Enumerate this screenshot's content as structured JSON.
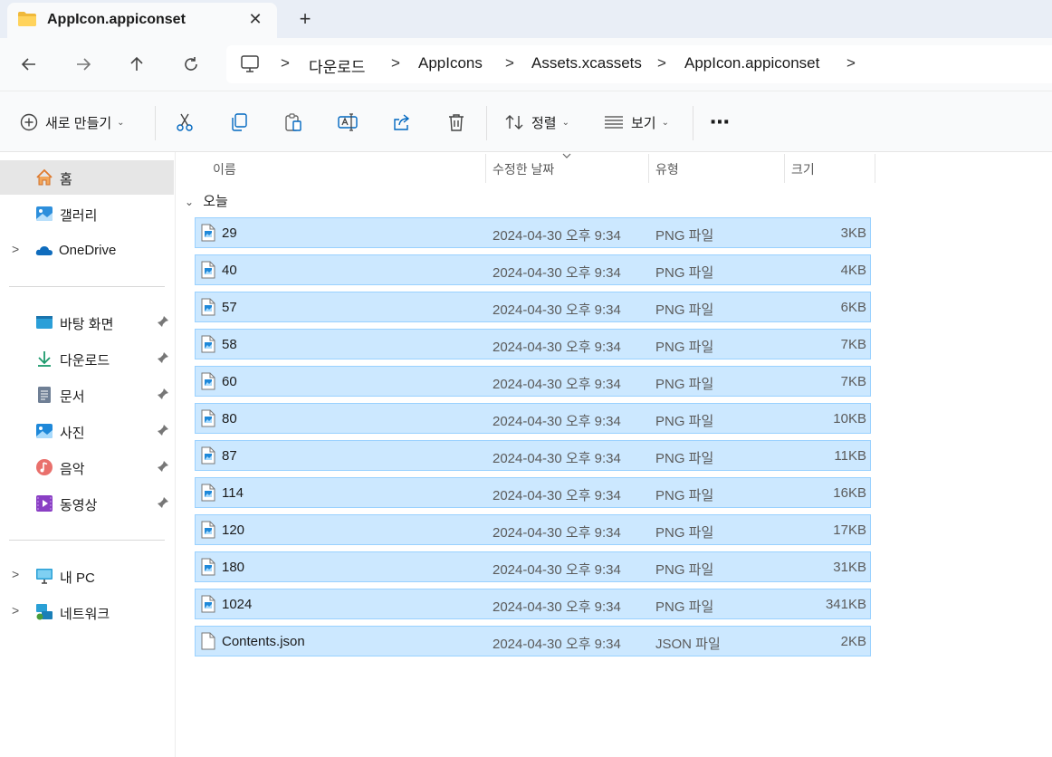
{
  "tab": {
    "title": "AppIcon.appiconset",
    "close": "✕",
    "new_tab": "+"
  },
  "address": {
    "crumbs": [
      "다운로드",
      "AppIcons",
      "Assets.xcassets",
      "AppIcon.appiconset"
    ],
    "separator": ">"
  },
  "commands": {
    "new": "새로 만들기",
    "sort": "정렬",
    "view": "보기",
    "more": "⋯"
  },
  "sidebar": {
    "items": [
      {
        "label": "홈",
        "icon": "home-icon"
      },
      {
        "label": "갤러리",
        "icon": "gallery-icon"
      },
      {
        "label": "OneDrive",
        "icon": "onedrive-icon"
      },
      {
        "label": "바탕 화면",
        "icon": "desktop-icon"
      },
      {
        "label": "다운로드",
        "icon": "download-icon"
      },
      {
        "label": "문서",
        "icon": "documents-icon"
      },
      {
        "label": "사진",
        "icon": "pictures-icon"
      },
      {
        "label": "음악",
        "icon": "music-icon"
      },
      {
        "label": "동영상",
        "icon": "videos-icon"
      },
      {
        "label": "내 PC",
        "icon": "this-pc-icon"
      },
      {
        "label": "네트워크",
        "icon": "network-icon"
      }
    ]
  },
  "columns": {
    "name": "이름",
    "modified": "수정한 날짜",
    "type": "유형",
    "size": "크기"
  },
  "group": {
    "label": "오늘"
  },
  "files": [
    {
      "name": "29",
      "date": "2024-04-30 오후 9:34",
      "type": "PNG 파일",
      "size": "3KB"
    },
    {
      "name": "40",
      "date": "2024-04-30 오후 9:34",
      "type": "PNG 파일",
      "size": "4KB"
    },
    {
      "name": "57",
      "date": "2024-04-30 오후 9:34",
      "type": "PNG 파일",
      "size": "6KB"
    },
    {
      "name": "58",
      "date": "2024-04-30 오후 9:34",
      "type": "PNG 파일",
      "size": "7KB"
    },
    {
      "name": "60",
      "date": "2024-04-30 오후 9:34",
      "type": "PNG 파일",
      "size": "7KB"
    },
    {
      "name": "80",
      "date": "2024-04-30 오후 9:34",
      "type": "PNG 파일",
      "size": "10KB"
    },
    {
      "name": "87",
      "date": "2024-04-30 오후 9:34",
      "type": "PNG 파일",
      "size": "11KB"
    },
    {
      "name": "114",
      "date": "2024-04-30 오후 9:34",
      "type": "PNG 파일",
      "size": "16KB"
    },
    {
      "name": "120",
      "date": "2024-04-30 오후 9:34",
      "type": "PNG 파일",
      "size": "17KB"
    },
    {
      "name": "180",
      "date": "2024-04-30 오후 9:34",
      "type": "PNG 파일",
      "size": "31KB"
    },
    {
      "name": "1024",
      "date": "2024-04-30 오후 9:34",
      "type": "PNG 파일",
      "size": "341KB"
    },
    {
      "name": "Contents.json",
      "date": "2024-04-30 오후 9:34",
      "type": "JSON 파일",
      "size": "2KB"
    }
  ],
  "colors": {
    "selection": "#cce8ff",
    "selection_border": "#99d1ff",
    "accent": "#0067c0"
  }
}
